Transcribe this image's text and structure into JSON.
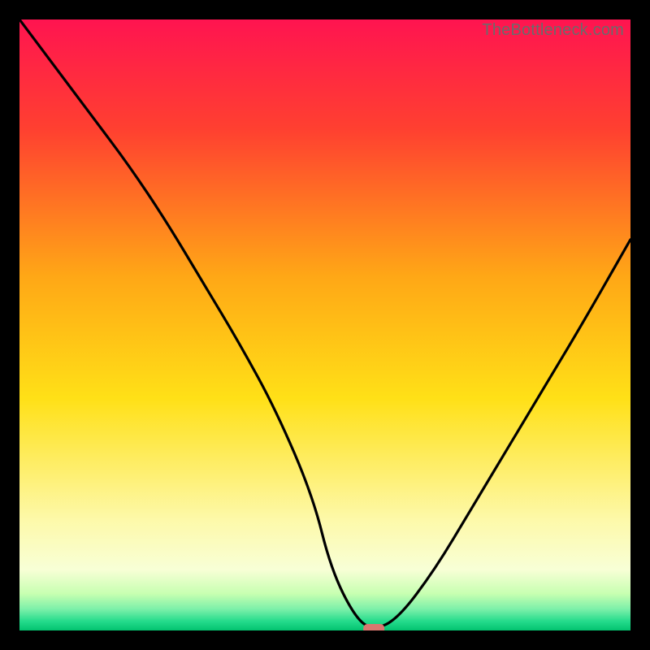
{
  "watermark": "TheBottleneck.com",
  "chart_data": {
    "type": "line",
    "title": "",
    "xlabel": "",
    "ylabel": "",
    "xlim": [
      0,
      100
    ],
    "ylim": [
      0,
      100
    ],
    "grid": false,
    "legend": false,
    "x": [
      0,
      6,
      12,
      18,
      24,
      30,
      36,
      42,
      48,
      51,
      55,
      58,
      62,
      68,
      74,
      80,
      86,
      92,
      100
    ],
    "values": [
      100,
      92,
      84,
      76,
      67,
      57,
      47,
      36,
      22,
      10,
      2,
      0,
      2,
      10,
      20,
      30,
      40,
      50,
      64
    ],
    "series_name": "bottleneck-curve",
    "min_marker": {
      "x": 58,
      "y": 0,
      "color": "#d9776f"
    },
    "gradient_stops": [
      {
        "offset": 0.0,
        "color": "#ff1450"
      },
      {
        "offset": 0.18,
        "color": "#ff4030"
      },
      {
        "offset": 0.42,
        "color": "#ffa716"
      },
      {
        "offset": 0.62,
        "color": "#ffe017"
      },
      {
        "offset": 0.82,
        "color": "#fdf9aa"
      },
      {
        "offset": 0.9,
        "color": "#f8ffd6"
      },
      {
        "offset": 0.94,
        "color": "#c7ffb1"
      },
      {
        "offset": 0.965,
        "color": "#7cf0a9"
      },
      {
        "offset": 0.985,
        "color": "#24db8c"
      },
      {
        "offset": 1.0,
        "color": "#02c36f"
      }
    ]
  }
}
